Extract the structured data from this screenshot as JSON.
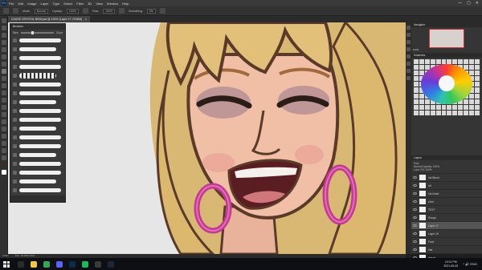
{
  "app": {
    "logo": "Ps"
  },
  "menubar": {
    "items": [
      "File",
      "Edit",
      "Image",
      "Layer",
      "Type",
      "Select",
      "Filter",
      "3D",
      "View",
      "Window",
      "Help"
    ],
    "window_controls": [
      "—",
      "▢",
      "✕"
    ]
  },
  "options": {
    "mode_label": "Mode:",
    "mode_value": "Normal",
    "opacity_label": "Opacity:",
    "opacity_value": "100%",
    "flow_label": "Flow:",
    "flow_value": "100%",
    "smoothing_label": "Smoothing:",
    "smoothing_value": "0%"
  },
  "document": {
    "tab_title": "CHASE CRYSTAL NEW.psd @ 100% (Layer 17, RGB/8)",
    "close": "×"
  },
  "brushes": {
    "title": "Brushes",
    "size_label": "Size:",
    "size_value": "20 px",
    "strokes": [
      1,
      2,
      3,
      4,
      5,
      6,
      7,
      8,
      9,
      10,
      11,
      12,
      13,
      14,
      15,
      16,
      17,
      18
    ]
  },
  "navigator": {
    "title": "Navigator",
    "zoom": "100%"
  },
  "swatches": {
    "title": "Swatches"
  },
  "layers": {
    "title": "Layers",
    "kind_label": "Kind",
    "blend_mode": "Normal",
    "opacity_label": "Opacity:",
    "opacity_value": "100%",
    "lock_label": "Lock:",
    "fill_label": "Fill:",
    "fill_value": "100%",
    "items": [
      {
        "name": "Ink Blend",
        "selected": false
      },
      {
        "name": "ref",
        "selected": false
      },
      {
        "name": "Ink Inked",
        "selected": false
      },
      {
        "name": "color",
        "selected": false
      },
      {
        "name": "TEXT",
        "selected": false
      },
      {
        "name": "Rough",
        "selected": false
      },
      {
        "name": "Layer 17",
        "selected": true
      },
      {
        "name": "Layer 16",
        "selected": false
      },
      {
        "name": "Face",
        "selected": false
      },
      {
        "name": "hair",
        "selected": false
      },
      {
        "name": "lineart",
        "selected": false
      }
    ]
  },
  "status": {
    "zoom": "100%",
    "doc": "Doc: 25.3M/2.26G"
  },
  "taskbar": {
    "icons": [
      {
        "name": "search",
        "color": "#2b2b2b"
      },
      {
        "name": "explorer",
        "color": "#f2c744"
      },
      {
        "name": "chrome",
        "color": "#34a853"
      },
      {
        "name": "discord",
        "color": "#5865f2"
      },
      {
        "name": "photoshop",
        "color": "#0f2b4a"
      },
      {
        "name": "spotify",
        "color": "#1db954"
      },
      {
        "name": "obs",
        "color": "#3a3a3a"
      },
      {
        "name": "steam",
        "color": "#1b2838"
      }
    ],
    "time": "10:11 PM",
    "date": "2021-09-02",
    "tray": "^  🔊  ENG"
  }
}
